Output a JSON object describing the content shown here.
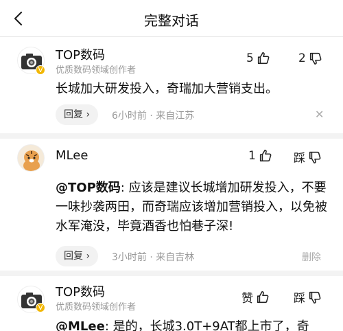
{
  "header": {
    "title": "完整对话"
  },
  "comments": [
    {
      "name": "TOP数码",
      "subtitle": "优质数码领域创作者",
      "like_count": "5",
      "dislike_count": "2",
      "text": "长城加大研发投入，奇瑞加大营销支出。",
      "reply_label": "回复",
      "time": "6小时前",
      "location": "来自江苏",
      "dot": "·"
    },
    {
      "name": "MLee",
      "like_count": "1",
      "dislike_label": "踩",
      "mention": "@TOP数码",
      "text": ": 应该是建议长城增加研发投入，不要一味抄袭两田，而奇瑞应该增加营销投入，以免被水军淹没，毕竟酒香也怕巷子深!",
      "reply_label": "回复",
      "time": "3小时前",
      "location": "来自吉林",
      "dot": "·",
      "delete_label": "删除"
    },
    {
      "name": "TOP数码",
      "subtitle": "优质数码领域创作者",
      "like_label": "赞",
      "dislike_label": "踩",
      "mention": "@MLee",
      "text": ": 是的，长城3.0T+9AT都上市了，奇"
    }
  ]
}
